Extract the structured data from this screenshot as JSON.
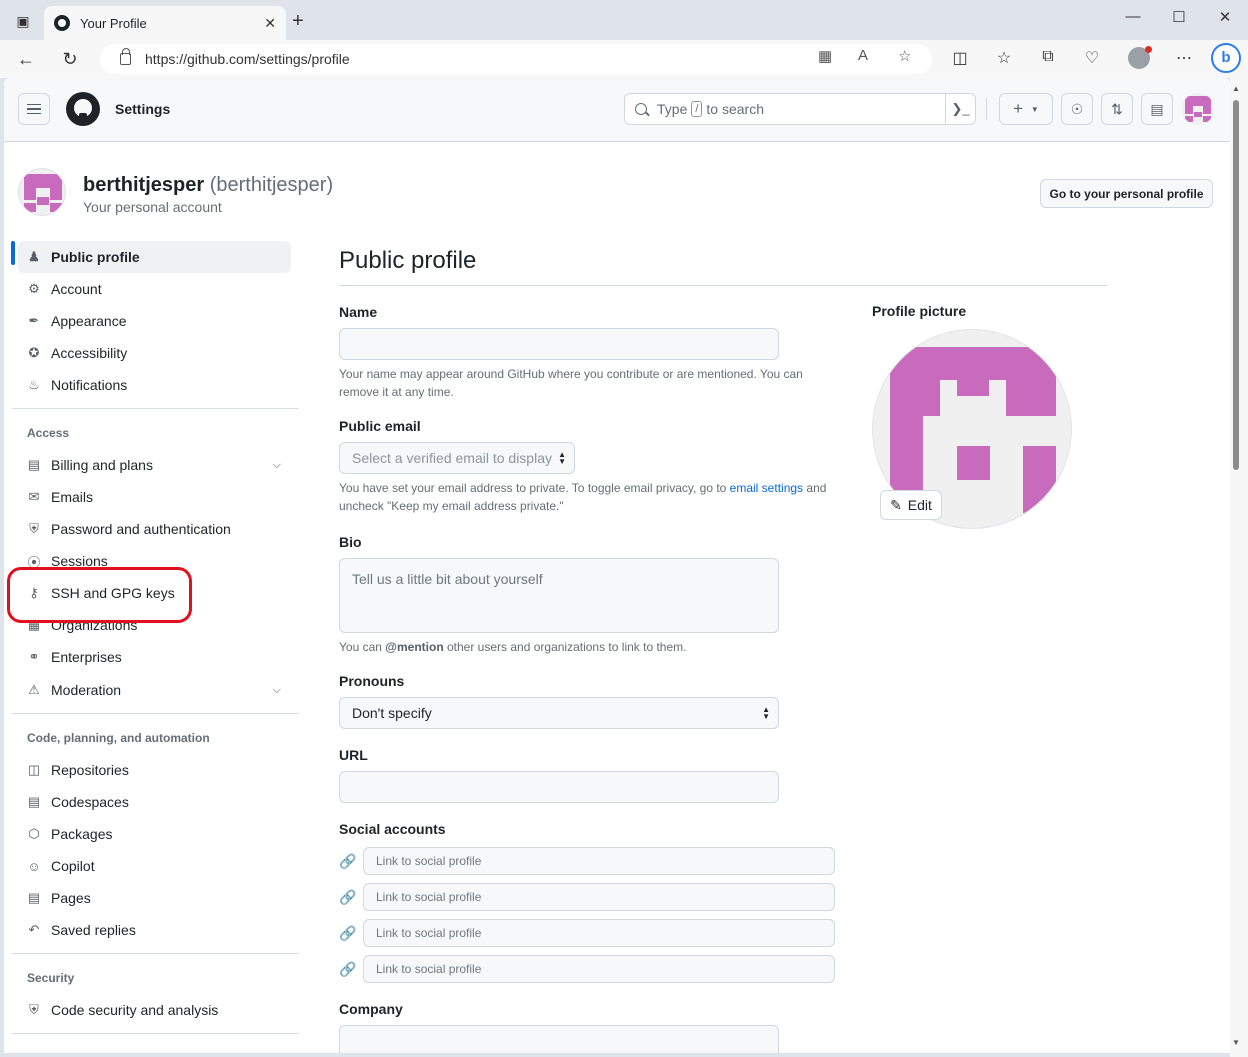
{
  "browser": {
    "tab_title": "Your Profile",
    "url": "https://github.com/settings/profile"
  },
  "header": {
    "title": "Settings",
    "search_prefix": "Type",
    "search_key": "/",
    "search_suffix": "to search",
    "cmd_glyph": "❯_"
  },
  "account": {
    "name": "berthitjesper",
    "login": "(berthitjesper)",
    "subtitle": "Your personal account",
    "go_profile_label": "Go to your personal profile"
  },
  "sidebar": {
    "items_top": [
      {
        "label": "Public profile",
        "icon": "person-icon"
      },
      {
        "label": "Account",
        "icon": "gear-icon"
      },
      {
        "label": "Appearance",
        "icon": "paintbrush-icon"
      },
      {
        "label": "Accessibility",
        "icon": "accessibility-icon"
      },
      {
        "label": "Notifications",
        "icon": "bell-icon"
      }
    ],
    "access_heading": "Access",
    "access_items": [
      {
        "label": "Billing and plans",
        "icon": "credit-card-icon"
      },
      {
        "label": "Emails",
        "icon": "mail-icon"
      },
      {
        "label": "Password and authentication",
        "icon": "shield-lock-icon"
      },
      {
        "label": "Sessions",
        "icon": "broadcast-icon"
      },
      {
        "label": "SSH and GPG keys",
        "icon": "key-icon"
      },
      {
        "label": "Organizations",
        "icon": "organization-icon"
      },
      {
        "label": "Enterprises",
        "icon": "globe-icon"
      },
      {
        "label": "Moderation",
        "icon": "report-icon"
      }
    ],
    "code_heading": "Code, planning, and automation",
    "code_items": [
      {
        "label": "Repositories",
        "icon": "repo-icon"
      },
      {
        "label": "Codespaces",
        "icon": "codespaces-icon"
      },
      {
        "label": "Packages",
        "icon": "package-icon"
      },
      {
        "label": "Copilot",
        "icon": "copilot-icon"
      },
      {
        "label": "Pages",
        "icon": "browser-icon"
      },
      {
        "label": "Saved replies",
        "icon": "reply-icon"
      }
    ],
    "security_heading": "Security",
    "security_items": [
      {
        "label": "Code security and analysis",
        "icon": "shield-icon"
      }
    ]
  },
  "main": {
    "title": "Public profile",
    "name_label": "Name",
    "name_value": "",
    "name_note": "Your name may appear around GitHub where you contribute or are mentioned. You can remove it at any time.",
    "email_label": "Public email",
    "email_select": "Select a verified email to display",
    "email_note_1": "You have set your email address to private. To toggle email privacy, go to",
    "email_note_link": "email settings",
    "email_note_2": "and uncheck \"Keep my email address private.\"",
    "bio_label": "Bio",
    "bio_placeholder": "Tell us a little bit about yourself",
    "bio_note_1": "You can",
    "bio_note_mention": "@mention",
    "bio_note_2": "other users and organizations to link to them.",
    "pronouns_label": "Pronouns",
    "pronouns_value": "Don't specify",
    "url_label": "URL",
    "url_value": "",
    "social_label": "Social accounts",
    "social_placeholder": "Link to social profile",
    "company_label": "Company",
    "profile_picture_label": "Profile picture",
    "edit_label": "Edit"
  },
  "colors": {
    "accent": "#0969da",
    "identicon": "#c96bbd",
    "highlight": "#e0101e"
  }
}
